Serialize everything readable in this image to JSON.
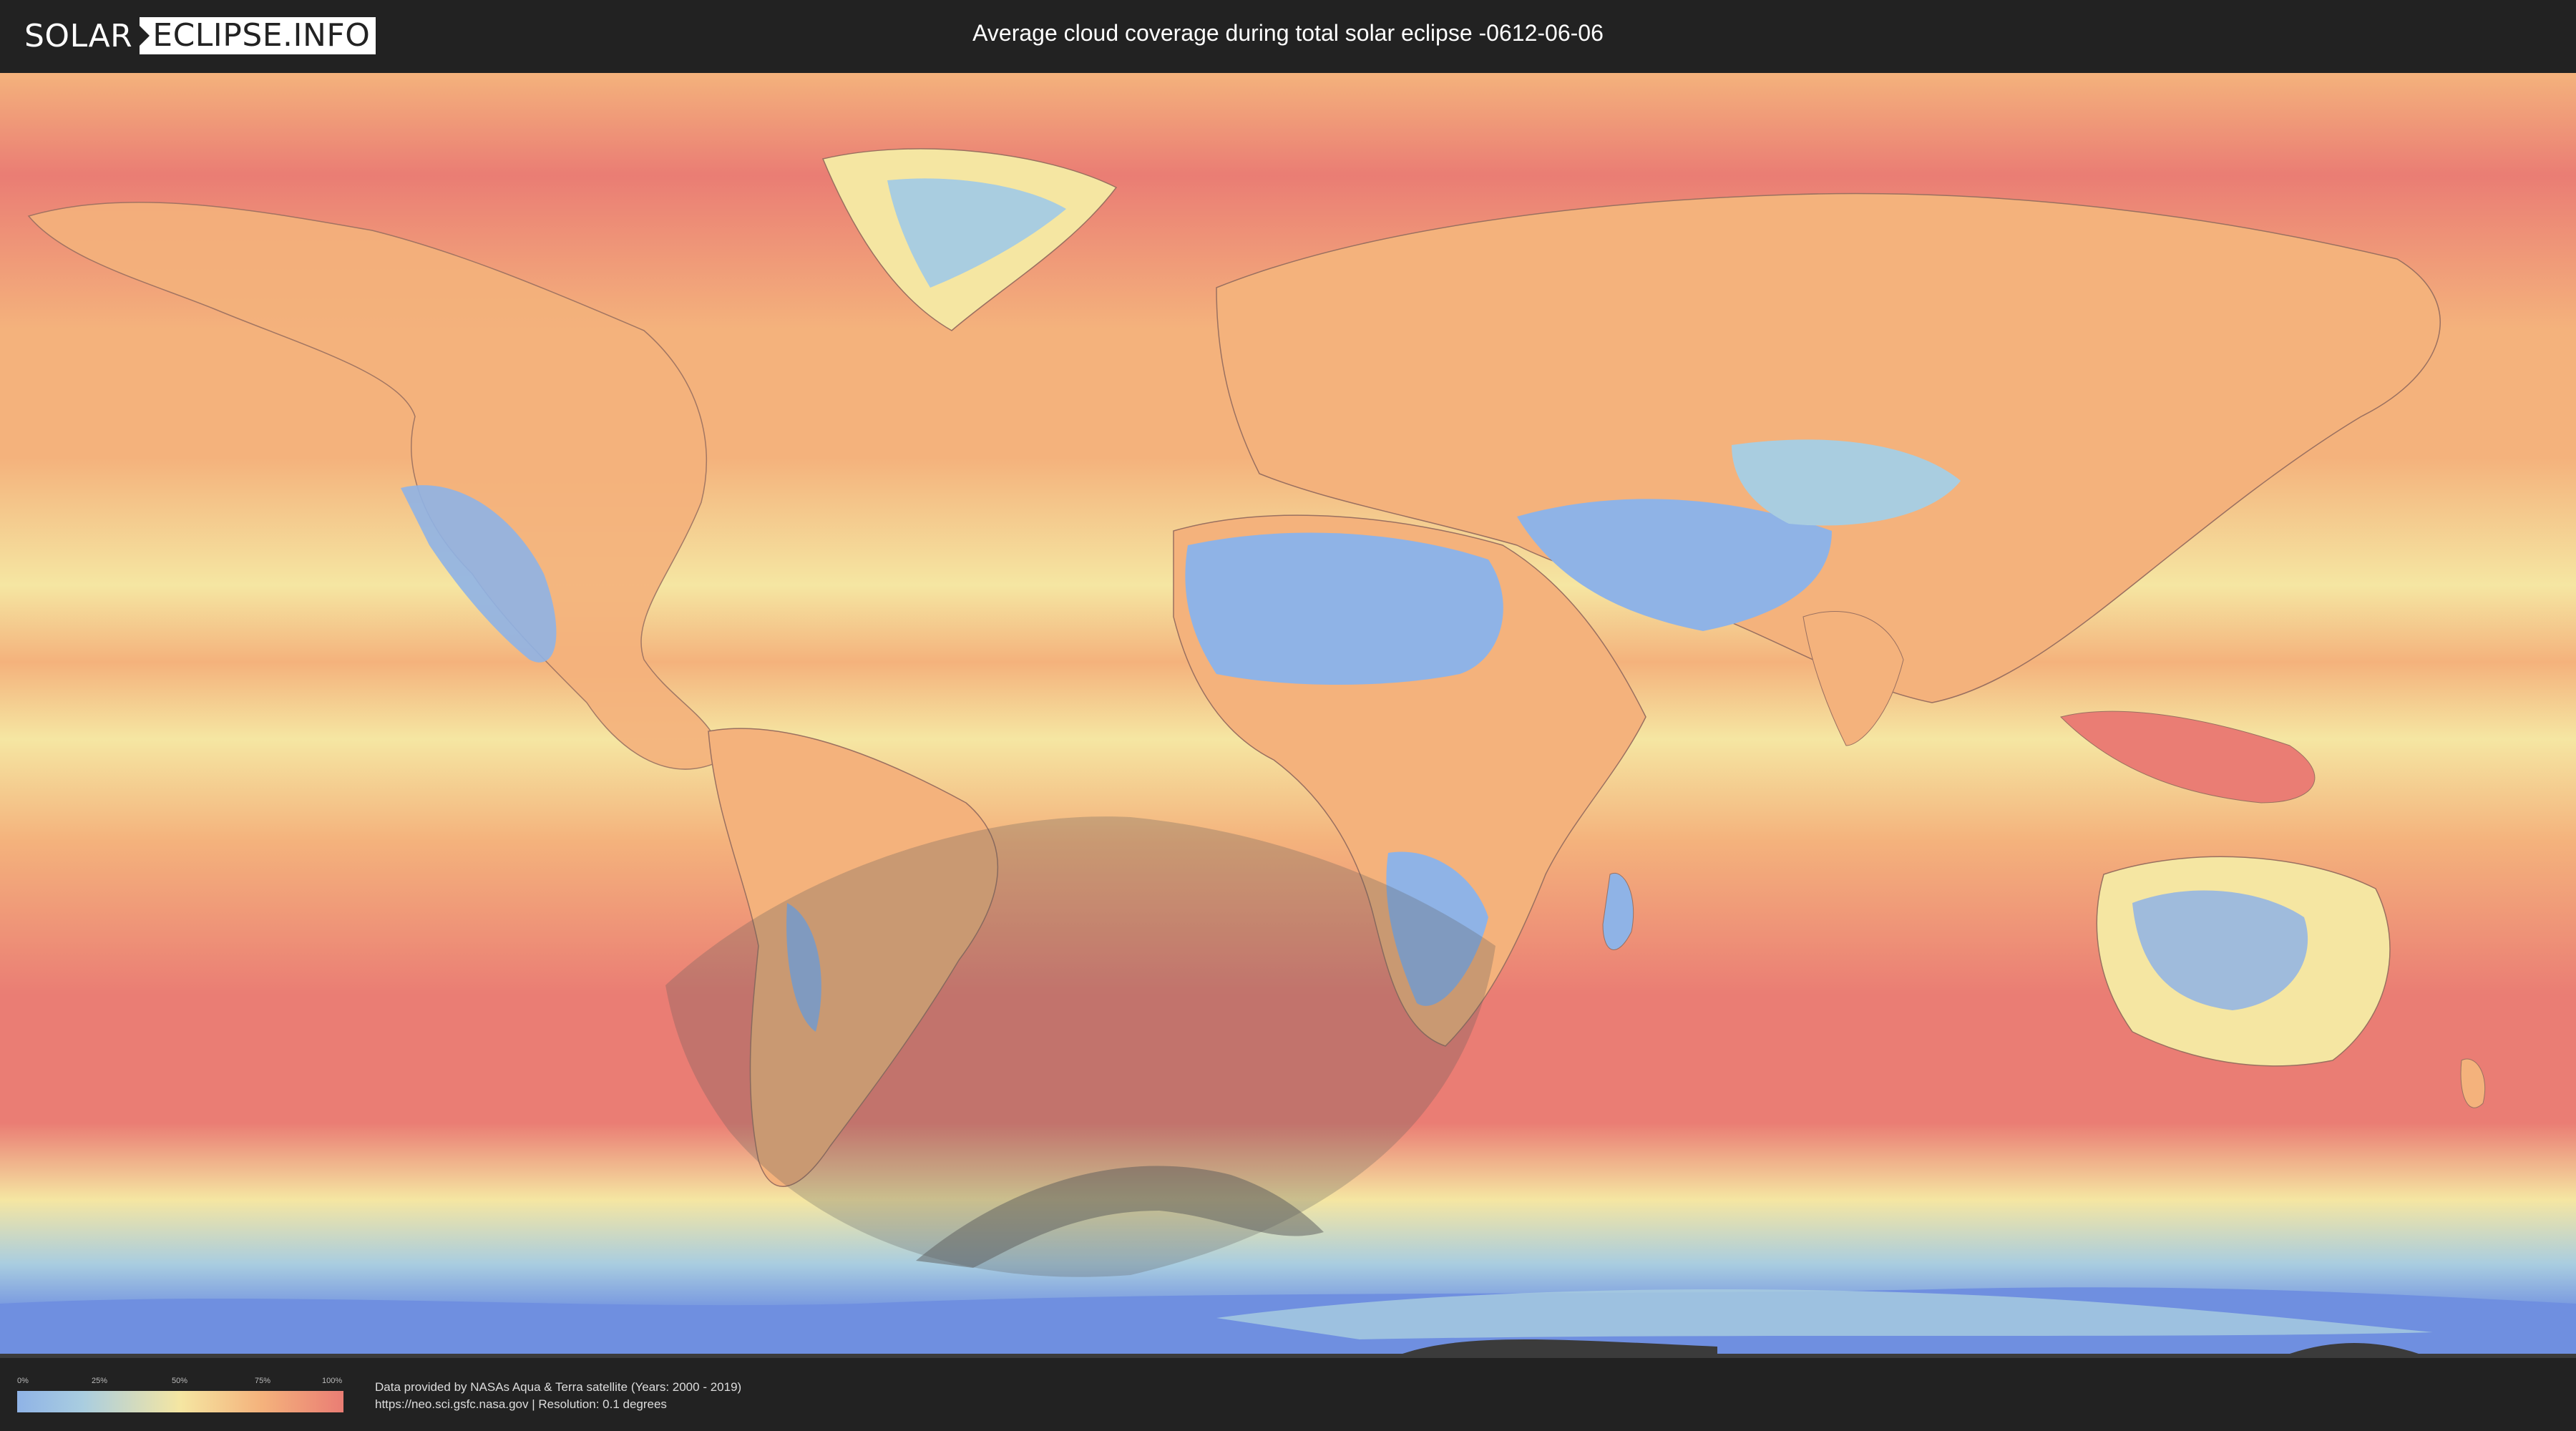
{
  "header": {
    "logo_left": "SOLAR",
    "logo_right": "ECLIPSE.INFO",
    "title": "Average cloud coverage during total solar eclipse -0612-06-06"
  },
  "legend": {
    "labels": [
      "0%",
      "25%",
      "50%",
      "75%",
      "100%"
    ],
    "colors": [
      "#8fb3e6",
      "#a9cde0",
      "#f5e6a2",
      "#f4b27c",
      "#ea7d74"
    ]
  },
  "credits": {
    "line1": "Data provided by NASAs Aqua & Terra satellite (Years: 2000 - 2019)",
    "line2": "https://neo.sci.gsfc.nasa.gov | Resolution: 0.1 degrees"
  },
  "map": {
    "colors": {
      "ocean_clear": "#f5e6a2",
      "ocean_cloudy": "#ea7d74",
      "mid": "#f4b27c",
      "land_clear": "#8fb3e6",
      "ice": "#6f8fe0",
      "eclipse_shadow": "#5a5a5a"
    }
  }
}
